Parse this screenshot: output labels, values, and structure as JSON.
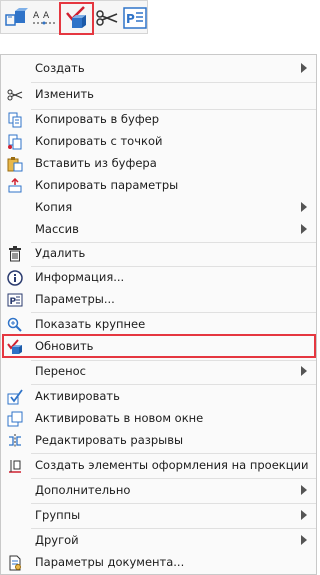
{
  "menu": {
    "items": [
      {
        "label": "Создать"
      },
      {
        "label": "Изменить"
      },
      {
        "label": "Копировать в буфер"
      },
      {
        "label": "Копировать с точкой"
      },
      {
        "label": "Вставить из буфера"
      },
      {
        "label": "Копировать параметры"
      },
      {
        "label": "Копия"
      },
      {
        "label": "Массив"
      },
      {
        "label": "Удалить"
      },
      {
        "label": "Информация..."
      },
      {
        "label": "Параметры..."
      },
      {
        "label": "Показать крупнее"
      },
      {
        "label": "Обновить"
      },
      {
        "label": "Перенос"
      },
      {
        "label": "Активировать"
      },
      {
        "label": "Активировать в новом окне"
      },
      {
        "label": "Редактировать разрывы"
      },
      {
        "label": "Создать элементы оформления на проекции"
      },
      {
        "label": "Дополнительно"
      },
      {
        "label": "Группы"
      },
      {
        "label": "Другой"
      },
      {
        "label": "Параметры документа..."
      }
    ]
  },
  "toolbar": {
    "parameters_icon_text": "P☰"
  },
  "colors": {
    "highlight": "#e53740",
    "accent": "#2f73c8",
    "check": "#d02030"
  }
}
